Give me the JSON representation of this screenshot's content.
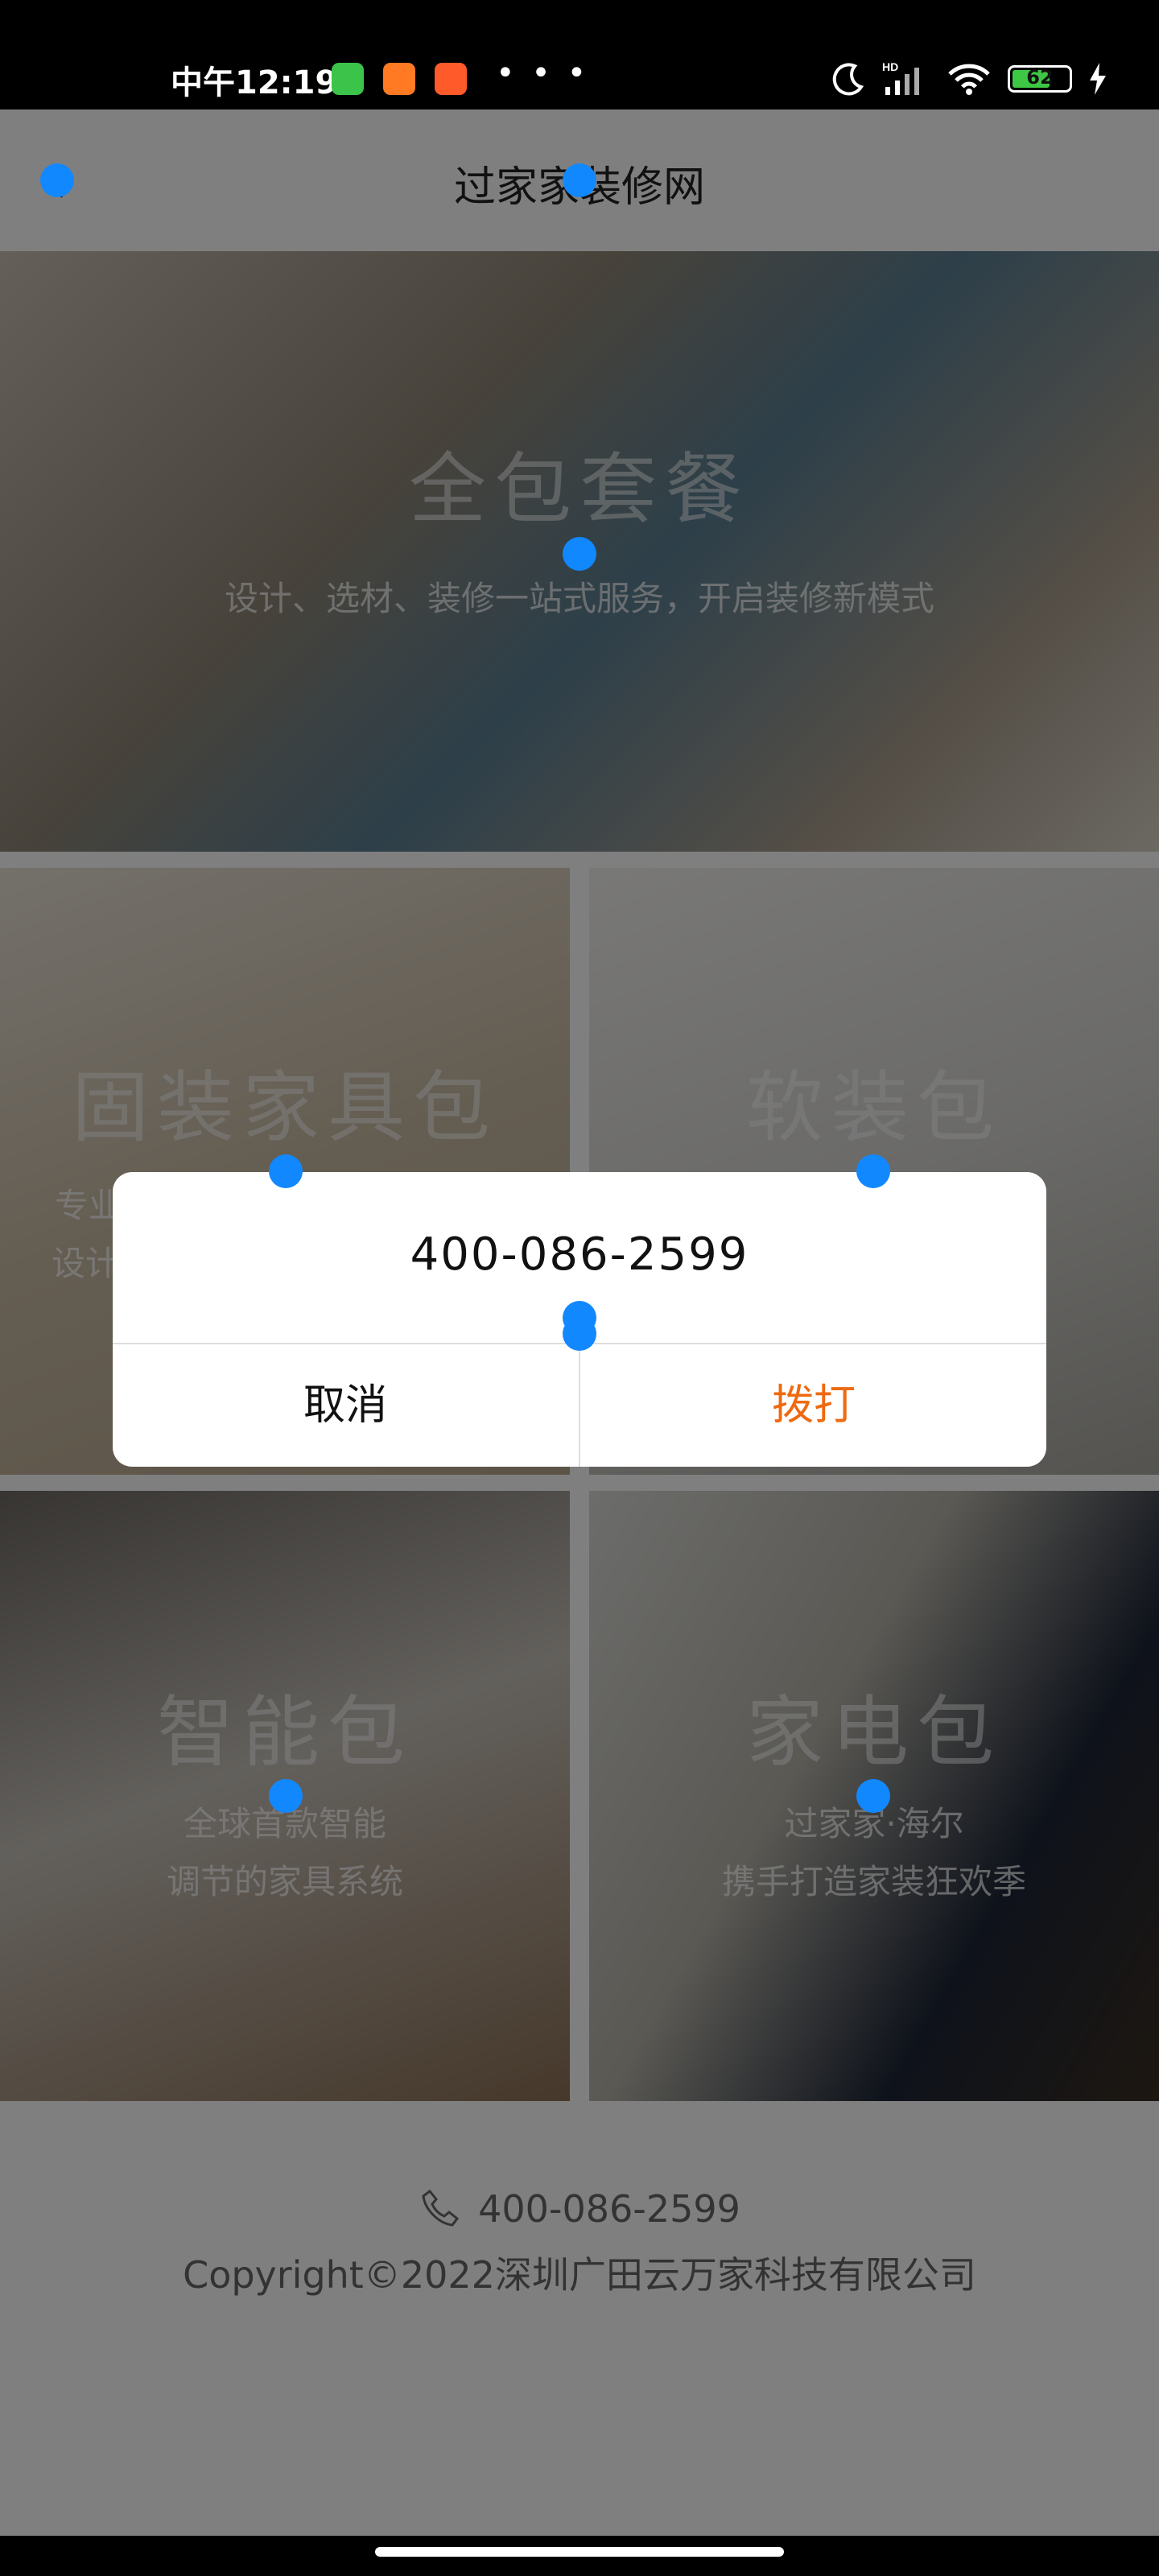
{
  "status_bar": {
    "time": "中午12:19",
    "dots": "• • •",
    "battery_level": "62",
    "hd_label": "HD"
  },
  "nav": {
    "title": "过家家装修网"
  },
  "hero": {
    "title": "全包套餐",
    "subtitle": "设计、选材、装修一站式服务，开启装修新模式"
  },
  "tiles": [
    {
      "title": "固装家具包",
      "sub1": "专业",
      "sub2": "设计"
    },
    {
      "title": "软装包",
      "sub1": "",
      "sub2": ""
    },
    {
      "title": "智能包",
      "sub1": "全球首款智能",
      "sub2": "调节的家具系统"
    },
    {
      "title": "家电包",
      "sub1": "过家家·海尔",
      "sub2": "携手打造家装狂欢季"
    }
  ],
  "footer": {
    "phone": "400-086-2599",
    "copyright": "Copyright©2022深圳广田云万家科技有限公司"
  },
  "dialog": {
    "message": "400-086-2599",
    "cancel_label": "取消",
    "confirm_label": "拨打"
  },
  "colors": {
    "accent": "#ee6a10",
    "touch": "#1288ff"
  }
}
